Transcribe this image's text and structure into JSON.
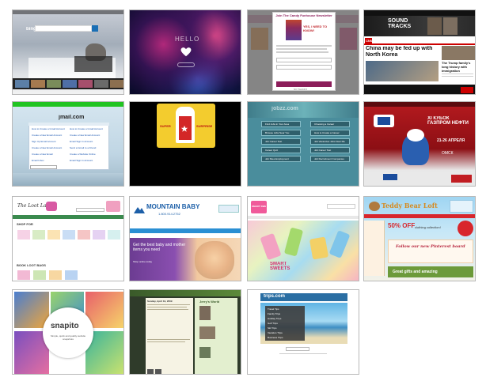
{
  "tiles": [
    {
      "name": "bing",
      "search_logo": "bing"
    },
    {
      "name": "space-heart",
      "text": "HELLO"
    },
    {
      "name": "newsletter-popup",
      "header": "Join The Candy Funhouse Newsletter",
      "button": "YES, I NEED TO KNOW!",
      "footer": "NO THANKS"
    },
    {
      "name": "cnn-soundtracks",
      "brand": "CNN",
      "banner": "SOUND TRACKS",
      "headline": "China may be fed up with North Korea",
      "side_headline": "The Trump family's long history with immigration"
    },
    {
      "name": "jmail",
      "logo": "jmail.com",
      "links": [
        "How to Create a Gmail Account",
        "Create a New Email Account",
        "Sign Up Email Account",
        "Create a New Email Account",
        "Create a New Email",
        "Email Inbox",
        "How to Create a Gmail Account",
        "Create a New Email Account",
        "Email Sign In Account",
        "Send a Gmail to a Friend",
        "Create a Website Online",
        "Email Sign In Account"
      ]
    },
    {
      "name": "card-character",
      "left": "SUPER",
      "right": "SURPRISE"
    },
    {
      "name": "careers-grid",
      "logo": "jobzz.com",
      "cells": [
        "Find Jobs in Your Area",
        "Choosing a Career",
        "Browse Jobs Near You",
        "How to Create a Career",
        "Job Career Test",
        "Job Vacancies Jobs Near Me",
        "Career Quiz",
        "Job Career Test",
        "Job Sites Employment",
        "Job Recruitment Companies"
      ]
    },
    {
      "name": "gazprom-hockey",
      "title": "XI КУБОК ГАЗПРОМ НЕФТИ",
      "dates": "21-26 АПРЕЛЯ",
      "city": "ОМСК"
    },
    {
      "name": "loot-lady",
      "logo": "The Loot Lady",
      "section1": "SHOP FOR",
      "section2": "BOOK LOOT BAGS"
    },
    {
      "name": "mountain-baby",
      "logo": "MOUNTAIN BABY",
      "phone": "1.800.914.2752",
      "hero": "Get the best baby and mother items you need",
      "hero_sub": "Shop online today"
    },
    {
      "name": "smart-sweets",
      "logo": "SMART SWEETS",
      "hero": "SMART SWEETS"
    },
    {
      "name": "teddy-bear-loft",
      "logo": "Teddy Bear Loft",
      "promo": "50% OFF",
      "sub": "clothing collection!",
      "pinterest": "Follow our new Pinterest board",
      "footer": "Great gifts and amazing"
    },
    {
      "name": "snapito",
      "logo": "snapito",
      "tagline": "Simple, quick and quality website snapshots"
    },
    {
      "name": "jerrys-world",
      "title": "Jerry's World",
      "post_date": "Sunday, April 19, 2009"
    },
    {
      "name": "trips",
      "logo": "trips.com",
      "items": [
        "Travel Tips",
        "Family Trips",
        "Holiday Trips",
        "Golf Trips",
        "Ski Trips",
        "Vacation Trips",
        "Business Trips"
      ]
    }
  ],
  "colors": {
    "border": "#b8b8b8",
    "bing_blue": "#1a6fb5",
    "cnn_red": "#cc0000",
    "jmail_green": "#21c421",
    "career_teal": "#4a8d9c",
    "teddy_red": "#d8262c"
  }
}
